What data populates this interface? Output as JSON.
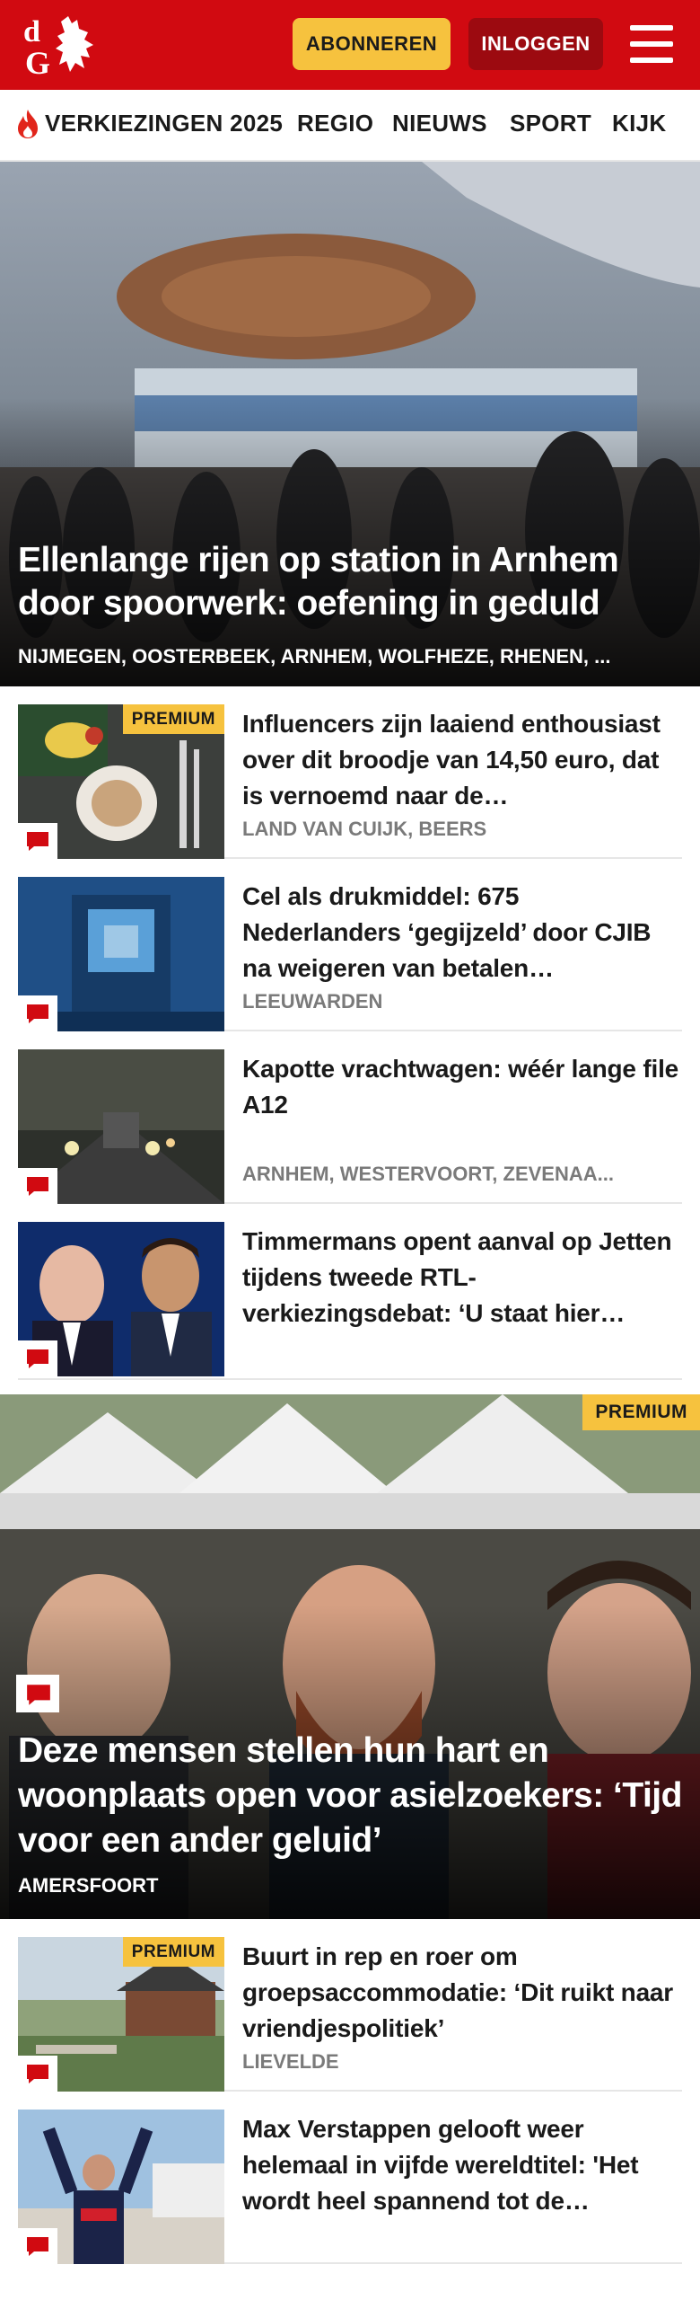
{
  "header": {
    "brand": "dG",
    "subscribe_label": "ABONNEREN",
    "login_label": "INLOGGEN",
    "brand_color": "#d10a11",
    "accent_color": "#f6c23e"
  },
  "nav": {
    "items": [
      {
        "label": "VERKIEZINGEN 2025",
        "icon": "flame-icon"
      },
      {
        "label": "REGIO"
      },
      {
        "label": "NIEUWS"
      },
      {
        "label": "SPORT"
      },
      {
        "label": "KIJK"
      }
    ]
  },
  "hero": {
    "title": "Ellenlange rijen op station in Arnhem door spoorwerk: oefening in geduld",
    "locations": "NIJMEGEN, OOSTERBEEK, ARNHEM, WOLFHEZE, RHENEN, ..."
  },
  "articles": [
    {
      "title": "Influencers zijn laaiend enthousiast over dit broodje van 14,50 euro, dat is vernoemd naar de…",
      "location": "LAND VAN CUIJK, BEERS",
      "premium_label": "PREMIUM"
    },
    {
      "title": "Cel als drukmiddel: 675 Nederlanders ‘gegijzeld’ door CJIB na weigeren van betalen…",
      "location": "LEEUWARDEN"
    },
    {
      "title": "Kapotte vrachtwagen: wéér lange file A12",
      "location": "ARNHEM, WESTERVOORT, ZEVENAA..."
    },
    {
      "title": "Timmermans opent aanval op Jetten tijdens tweede RTL-verkiezingsdebat: ‘U staat hier…",
      "location": ""
    }
  ],
  "feature": {
    "premium_label": "PREMIUM",
    "title": "Deze mensen stellen hun hart en woonplaats open voor asielzoekers: ‘Tijd voor een ander geluid’",
    "location": "AMERSFOORT"
  },
  "articles2": [
    {
      "title": "Buurt in rep en roer om groepsaccommodatie: ‘Dit ruikt naar vriendjespolitiek’",
      "location": "LIEVELDE",
      "premium_label": "PREMIUM"
    },
    {
      "title": "Max Verstappen gelooft weer helemaal in vijfde wereldtitel: 'Het wordt heel spannend tot de…",
      "location": ""
    }
  ]
}
